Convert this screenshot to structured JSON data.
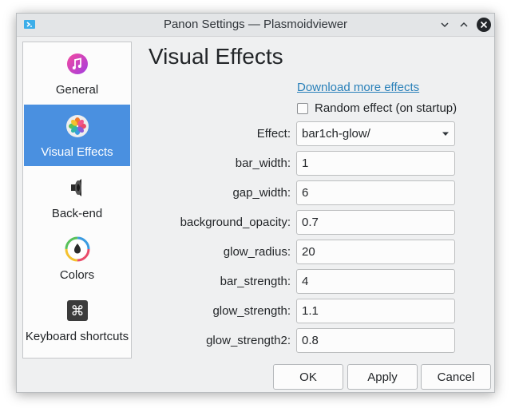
{
  "window": {
    "title": "Panon Settings — Plasmoidviewer",
    "app_icon": "monitor-arrow-icon",
    "controls": [
      "minimize-icon",
      "maximize-icon",
      "close-icon"
    ]
  },
  "sidebar": {
    "items": [
      {
        "label": "General",
        "icon": "music-note-icon",
        "selected": false
      },
      {
        "label": "Visual Effects",
        "icon": "flower-icon",
        "selected": true
      },
      {
        "label": "Back-end",
        "icon": "speaker-icon",
        "selected": false
      },
      {
        "label": "Colors",
        "icon": "color-drop-icon",
        "selected": false
      },
      {
        "label": "Keyboard shortcuts",
        "icon": "command-key-icon",
        "selected": false
      }
    ]
  },
  "main": {
    "heading": "Visual Effects",
    "download_link": "Download more effects",
    "random_checkbox": {
      "label": "Random effect (on startup)",
      "checked": false
    },
    "effect": {
      "label": "Effect:",
      "value": "bar1ch-glow/"
    },
    "fields": [
      {
        "label": "bar_width:",
        "value": "1"
      },
      {
        "label": "gap_width:",
        "value": "6"
      },
      {
        "label": "background_opacity:",
        "value": "0.7"
      },
      {
        "label": "glow_radius:",
        "value": "20"
      },
      {
        "label": "bar_strength:",
        "value": "4"
      },
      {
        "label": "glow_strength:",
        "value": "1.1"
      },
      {
        "label": "glow_strength2:",
        "value": "0.8"
      }
    ]
  },
  "buttons": {
    "ok": "OK",
    "apply": "Apply",
    "cancel": "Cancel"
  },
  "colors": {
    "selection": "#4a90e0",
    "link": "#2980b9",
    "window_bg": "#eff0f1"
  }
}
